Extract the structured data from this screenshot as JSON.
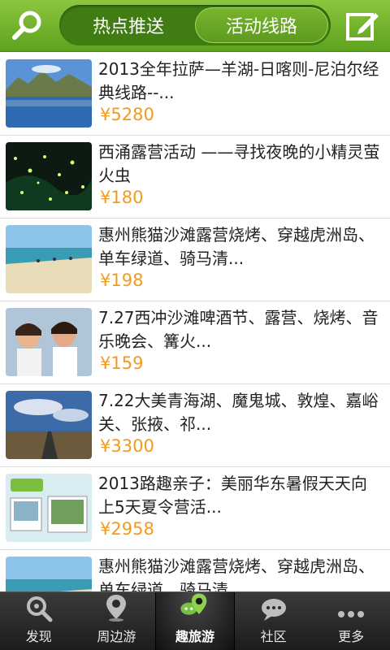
{
  "header": {
    "tabs": [
      {
        "label": "热点推送",
        "active": false
      },
      {
        "label": "活动线路",
        "active": true
      }
    ],
    "search_icon": "search-icon",
    "edit_icon": "edit-icon",
    "accent": "#6fb22a"
  },
  "list": {
    "price_color": "#f39a1e",
    "items": [
      {
        "title": "2013全年拉萨—羊湖-日喀则-尼泊尔经典线路--...",
        "price": "¥5280"
      },
      {
        "title": "西涌露营活动 ——寻找夜晚的小精灵萤火虫",
        "price": "¥180"
      },
      {
        "title": "惠州熊猫沙滩露营烧烤、穿越虎洲岛、单车绿道、骑马清...",
        "price": "¥198"
      },
      {
        "title": "7.27西冲沙滩啤酒节、露营、烧烤、音乐晚会、篝火...",
        "price": "¥159"
      },
      {
        "title": "7.22大美青海湖、魔鬼城、敦煌、嘉峪关、张掖、祁...",
        "price": "¥3300"
      },
      {
        "title": "2013路趣亲子：美丽华东暑假天天向上5天夏令营活...",
        "price": "¥2958"
      },
      {
        "title": "惠州熊猫沙滩露营烧烤、穿越虎洲岛、单车绿道、骑马清...",
        "price": ""
      }
    ]
  },
  "tabbar": {
    "items": [
      {
        "label": "发现",
        "icon": "discover-icon"
      },
      {
        "label": "周边游",
        "icon": "location-pin-icon"
      },
      {
        "label": "趣旅游",
        "icon": "chat-pin-icon",
        "active": true
      },
      {
        "label": "社区",
        "icon": "speech-bubble-icon"
      },
      {
        "label": "更多",
        "icon": "more-dots-icon"
      }
    ]
  }
}
